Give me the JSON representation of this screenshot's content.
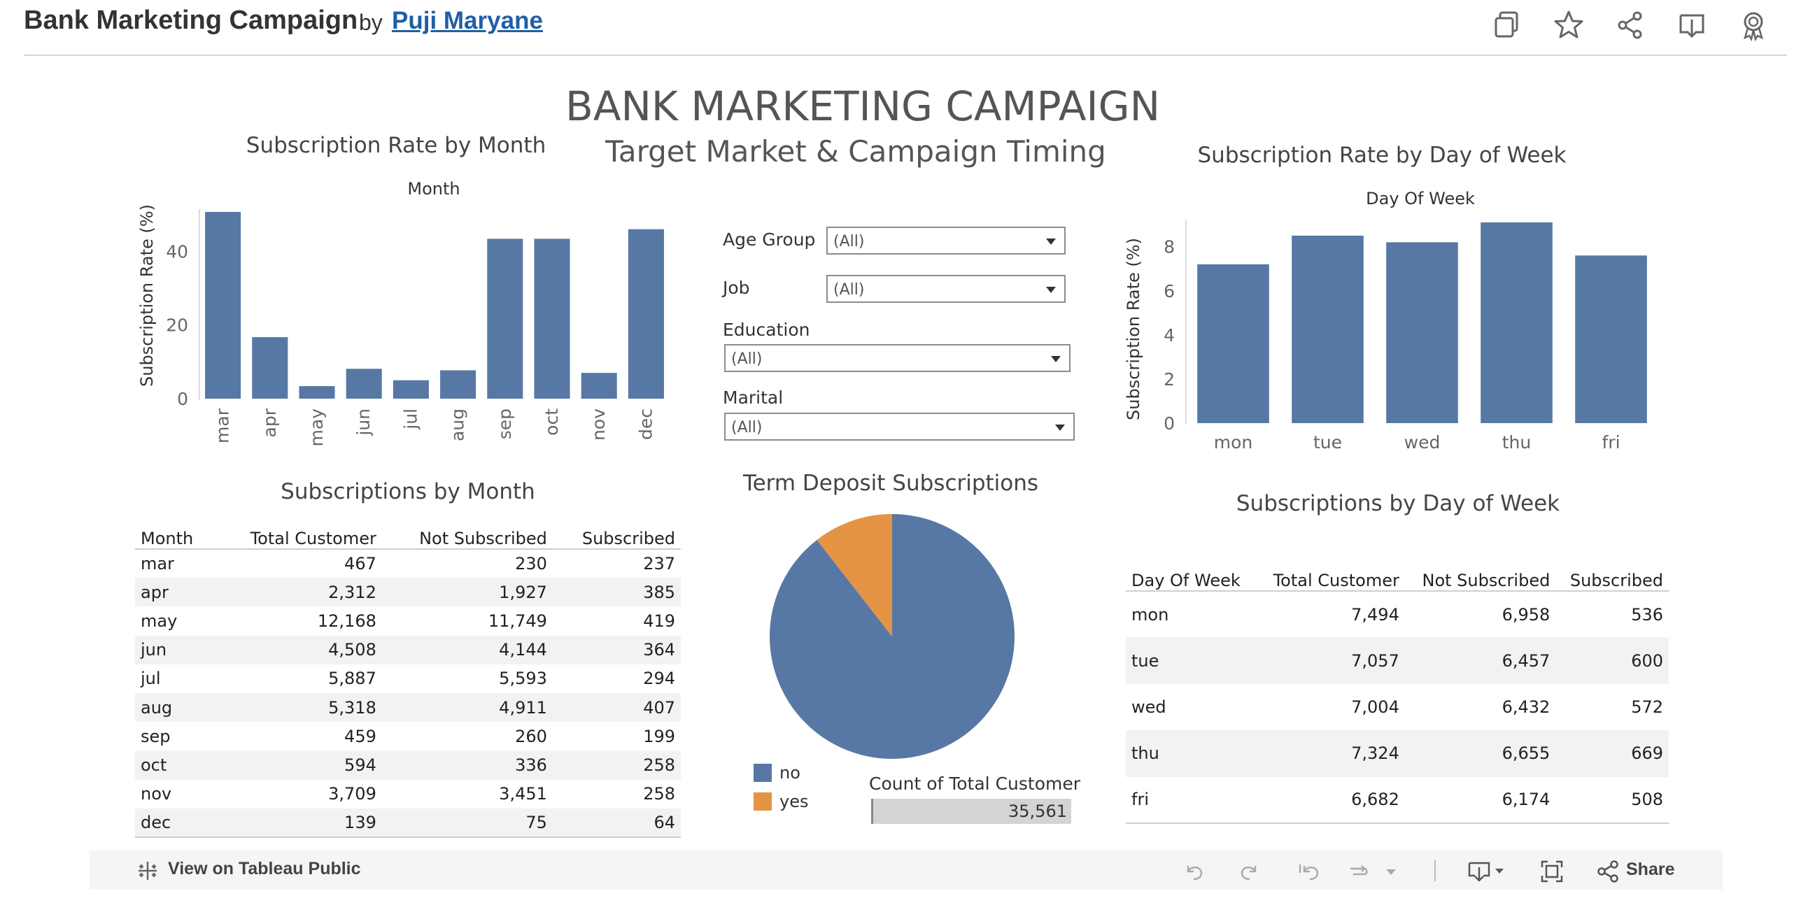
{
  "header": {
    "title": "Bank Marketing Campaign",
    "by": "by",
    "author": "Puji Maryane",
    "toolbar_icons": [
      "duplicate-icon",
      "star-icon",
      "share-icon",
      "download-icon",
      "award-icon"
    ]
  },
  "dashboard": {
    "title": "BANK MARKETING CAMPAIGN",
    "subtitle": "Target Market & Campaign Timing"
  },
  "colors": {
    "bar": "#5778a4",
    "pie_no": "#5778a4",
    "pie_yes": "#e49444",
    "alt_row": "#f2f2f2"
  },
  "filters": [
    {
      "label": "Age Group",
      "value": "(All)"
    },
    {
      "label": "Job",
      "value": "(All)"
    },
    {
      "label": "Education",
      "value": "(All)"
    },
    {
      "label": "Marital",
      "value": "(All)"
    }
  ],
  "chart_data": [
    {
      "id": "rate_by_month",
      "type": "bar",
      "title": "Subscription Rate by Month",
      "xlabel": "Month",
      "ylabel": "Subscription Rate (%)",
      "categories": [
        "mar",
        "apr",
        "may",
        "jun",
        "jul",
        "aug",
        "sep",
        "oct",
        "nov",
        "dec"
      ],
      "values": [
        50.7,
        16.7,
        3.4,
        8.1,
        5.0,
        7.7,
        43.4,
        43.4,
        7.0,
        46.0
      ],
      "ylim": [
        0,
        50.7
      ],
      "yticks": [
        0,
        20,
        40
      ],
      "grid": false
    },
    {
      "id": "rate_by_day",
      "type": "bar",
      "title": "Subscription Rate by Day of Week",
      "xlabel": "Day Of Week",
      "ylabel": "Subscription Rate (%)",
      "categories": [
        "mon",
        "tue",
        "wed",
        "thu",
        "fri"
      ],
      "values": [
        7.2,
        8.5,
        8.2,
        9.1,
        7.6
      ],
      "ylim": [
        0,
        9.1
      ],
      "yticks": [
        0,
        2,
        4,
        6,
        8
      ],
      "grid": false
    },
    {
      "id": "term_deposit_pie",
      "type": "pie",
      "title": "Term Deposit Subscriptions",
      "categories": [
        "no",
        "yes"
      ],
      "values": [
        31815,
        3746
      ]
    }
  ],
  "tables": {
    "month": {
      "title": "Subscriptions by Month",
      "columns": [
        "Month",
        "Total Customer",
        "Not Subscribed",
        "Subscribed"
      ],
      "rows": [
        [
          "mar",
          "467",
          "230",
          "237"
        ],
        [
          "apr",
          "2,312",
          "1,927",
          "385"
        ],
        [
          "may",
          "12,168",
          "11,749",
          "419"
        ],
        [
          "jun",
          "4,508",
          "4,144",
          "364"
        ],
        [
          "jul",
          "5,887",
          "5,593",
          "294"
        ],
        [
          "aug",
          "5,318",
          "4,911",
          "407"
        ],
        [
          "sep",
          "459",
          "260",
          "199"
        ],
        [
          "oct",
          "594",
          "336",
          "258"
        ],
        [
          "nov",
          "3,709",
          "3,451",
          "258"
        ],
        [
          "dec",
          "139",
          "75",
          "64"
        ]
      ]
    },
    "day": {
      "title": "Subscriptions by Day of Week",
      "columns": [
        "Day Of Week",
        "Total Customer",
        "Not Subscribed",
        "Subscribed"
      ],
      "rows": [
        [
          "mon",
          "7,494",
          "6,958",
          "536"
        ],
        [
          "tue",
          "7,057",
          "6,457",
          "600"
        ],
        [
          "wed",
          "7,004",
          "6,432",
          "572"
        ],
        [
          "thu",
          "7,324",
          "6,655",
          "669"
        ],
        [
          "fri",
          "6,682",
          "6,174",
          "508"
        ]
      ]
    }
  },
  "count": {
    "label": "Count of Total Customer",
    "value": "35,561"
  },
  "footer": {
    "view_label": "View on Tableau Public",
    "share_label": "Share",
    "icons": [
      "undo-icon",
      "redo-icon",
      "revert-icon",
      "refresh-icon",
      "dropdown-icon",
      "download-icon",
      "fullscreen-icon",
      "share-icon"
    ]
  }
}
